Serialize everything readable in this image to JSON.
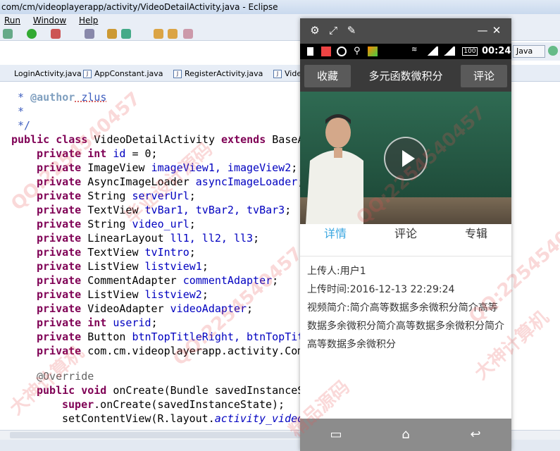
{
  "window": {
    "title": "com/cm/videoplayerapp/activity/VideoDetailActivity.java - Eclipse"
  },
  "menu": [
    "Run",
    "Window",
    "Help"
  ],
  "perspective": {
    "label": "Java"
  },
  "editor_tabs": [
    {
      "label": "LoginActivity.java"
    },
    {
      "label": "AppConstant.java"
    },
    {
      "label": "RegisterActivity.java"
    },
    {
      "label": "Vide"
    }
  ],
  "code": {
    "l1": {
      "pre": " * ",
      "tag": "@author",
      "text": " zlus"
    },
    "l2": " *",
    "l3": " */",
    "l4": {
      "k1": "public class ",
      "name": "VideoDetailActivity ",
      "k2": "extends ",
      "rest": "BaseA"
    },
    "fields": [
      {
        "t": "int ",
        "n": "id",
        "r": " = 0;"
      },
      {
        "t": "ImageView ",
        "n": "imageView1, imageView2",
        "r": ";"
      },
      {
        "t": "AsyncImageLoader ",
        "n": "asyncImageLoader",
        "r": ";"
      },
      {
        "t": "String ",
        "n": "serverUrl",
        "r": ";"
      },
      {
        "t": "TextView ",
        "n": "tvBar1, tvBar2, tvBar3",
        "r": ";"
      },
      {
        "t": "String ",
        "n": "video_url",
        "r": ";"
      },
      {
        "t": "LinearLayout ",
        "n": "ll1, ll2, ll3",
        "r": ";"
      },
      {
        "t": "TextView ",
        "n": "tvIntro",
        "r": ";"
      },
      {
        "t": "ListView ",
        "n": "listview1",
        "r": ";"
      },
      {
        "t": "CommentAdapter ",
        "n": "commentAdapter",
        "r": ";"
      },
      {
        "t": "ListView ",
        "n": "listview2",
        "r": ";"
      },
      {
        "t": "VideoAdapter ",
        "n": "videoAdapter",
        "r": ";"
      },
      {
        "t": "int ",
        "n": "userid",
        "r": ";"
      },
      {
        "t": "Button ",
        "n": "btnTopTitleRight, btnTopTit",
        "r": ""
      },
      {
        "t": "com.cm.videoplayerapp.activity.Com",
        "n": "",
        "r": ""
      }
    ],
    "private_kw": "private ",
    "override": "@Override",
    "oncreate": {
      "k1": "public void ",
      "rest": "onCreate(Bundle savedInstanceS"
    },
    "super_line": {
      "k": "super",
      "rest": ".onCreate(savedInstanceState);"
    },
    "setcontent": {
      "pre": "setContentView(R.layout.",
      "it": "activity_video"
    }
  },
  "phone": {
    "status": {
      "time": "00:24",
      "battery": "100"
    },
    "app": {
      "left_btn": "收藏",
      "title": "多元函数微积分",
      "right_btn": "评论"
    },
    "tabs": [
      {
        "label": "详情",
        "color": "#3aa6e0"
      },
      {
        "label": "评论",
        "color": "#333333"
      },
      {
        "label": "专辑",
        "color": "#333333"
      }
    ],
    "details": {
      "uploader": "上传人:用户1",
      "upload_time": "上传时间:2016-12-13 22:29:24",
      "intro": "视频简介:简介高等数据多余微积分简介高等数据多余微积分简介高等数据多余微积分简介高等数据多余微积分"
    }
  },
  "watermarks": [
    "QQ:2254540457",
    "大神计算机",
    "毕业设计源码",
    "精品源码"
  ]
}
